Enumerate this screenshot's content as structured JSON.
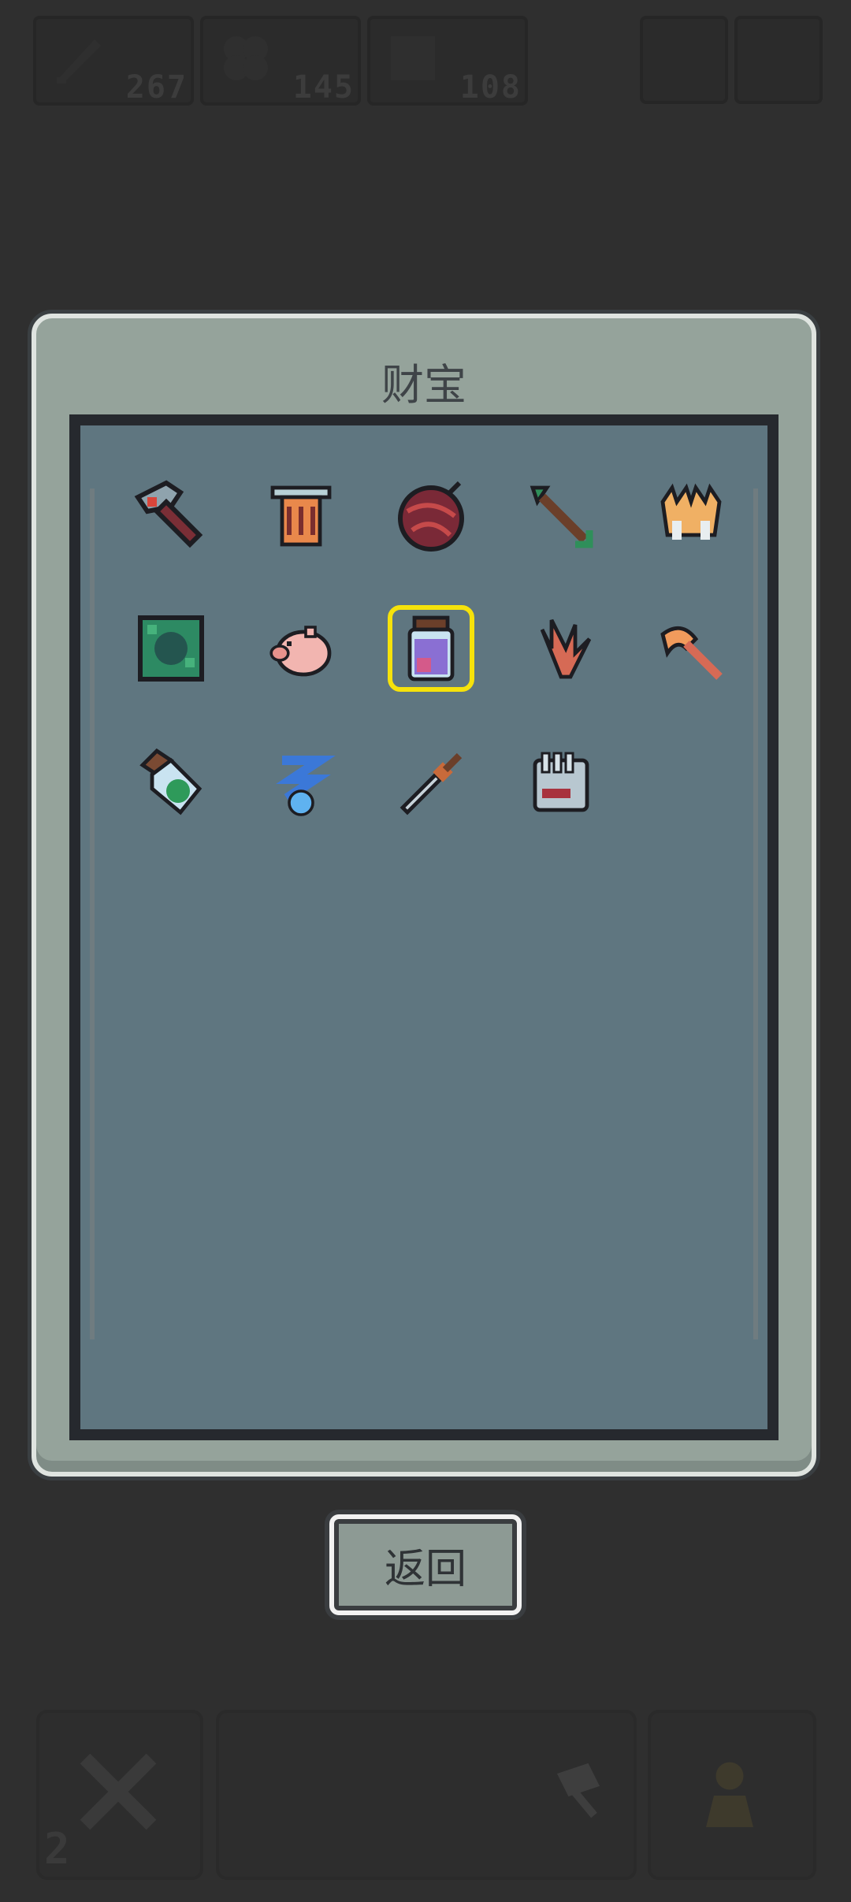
{
  "hud": {
    "resources": [
      {
        "icon": "feather-icon",
        "value": "267"
      },
      {
        "icon": "clover-icon",
        "value": "145"
      },
      {
        "icon": "token-icon",
        "value": "108"
      }
    ]
  },
  "panel": {
    "title": "财宝",
    "items": [
      {
        "name": "hammer-icon"
      },
      {
        "name": "lantern-icon"
      },
      {
        "name": "yarn-ball-icon"
      },
      {
        "name": "arrow-icon"
      },
      {
        "name": "crown-claw-icon"
      },
      {
        "name": "moss-block-icon"
      },
      {
        "name": "pig-icon"
      },
      {
        "name": "potion-jar-icon",
        "selected": true
      },
      {
        "name": "feather-leaf-icon"
      },
      {
        "name": "axe-icon"
      },
      {
        "name": "green-bottle-icon"
      },
      {
        "name": "blue-swirl-icon"
      },
      {
        "name": "dagger-icon"
      },
      {
        "name": "gauntlet-icon"
      }
    ]
  },
  "back_button": {
    "label": "返回"
  },
  "bottom_nav": {
    "left_count": "2"
  },
  "colors": {
    "background": "#2f2f2f",
    "panel": "#95a39b",
    "inner": "#5f7680",
    "selection": "#f6e20b"
  }
}
